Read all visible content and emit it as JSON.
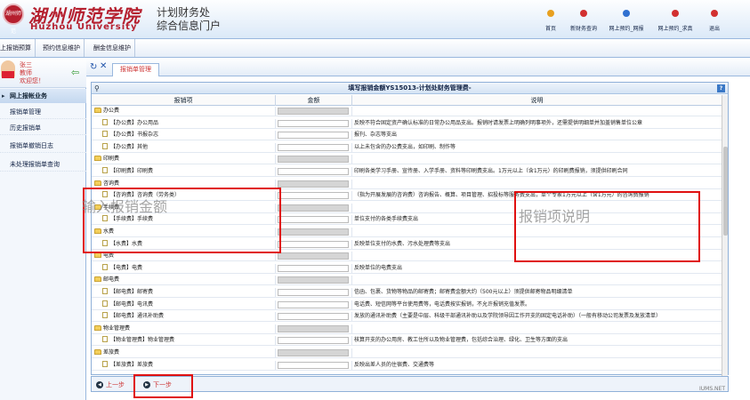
{
  "header": {
    "logo_text": "湖州师范",
    "school_cn": "湖州师范学院",
    "school_en": "Huzhou University",
    "system_line1": "计划财务处",
    "system_line2": "综合信息门户",
    "nav": [
      {
        "label": "首页",
        "color": "#e8a020"
      },
      {
        "label": "新财务查询",
        "color": "#d23030"
      },
      {
        "label": "网上预约_网报",
        "color": "#3070d0"
      },
      {
        "label": "网上预约_求真",
        "color": "#d23030"
      },
      {
        "label": "退出",
        "color": "#d23030"
      }
    ]
  },
  "menubar": {
    "tabs": [
      "上报销预算",
      "预约信息维护",
      "酬金信息维护"
    ]
  },
  "sidebar": {
    "user_name": "张三",
    "user_role": "教师",
    "welcome": "欢迎您！",
    "section": "网上报帐业务",
    "items": [
      "报销单管理",
      "历史报销单",
      "报销单撤销日志",
      "未处理报销单查询"
    ]
  },
  "tabs": {
    "active": "报销单管理"
  },
  "panel": {
    "title": "填写报销金额YS15013-计划处财务管理费-",
    "col_item": "报销项",
    "col_amount": "金额",
    "col_desc": "说明"
  },
  "rows": [
    {
      "type": "cat",
      "label": "办公费",
      "desc": ""
    },
    {
      "type": "item",
      "label": "【办公费】办公用品",
      "desc": "反映不符合固定资产确认标准的日常办公用品支出。报销时请发票上明确列明事项外，还需提供明细单并加盖销售单位公章"
    },
    {
      "type": "item",
      "label": "【办公费】书报杂志",
      "desc": "报刊、杂志等支出"
    },
    {
      "type": "item",
      "label": "【办公费】其他",
      "desc": "以上未包含的办公费支出，如印刷、制作等"
    },
    {
      "type": "cat",
      "label": "印刷费",
      "desc": ""
    },
    {
      "type": "item",
      "label": "【印刷费】印刷费",
      "desc": "印刷各类学习手册、宣传册、入学手册、资料等印刷费支出。1万元以上（含1万元）的印刷费报销，须提供印刷合同"
    },
    {
      "type": "cat",
      "label": "咨询费",
      "desc": ""
    },
    {
      "type": "item",
      "label": "【咨询费】咨询费（劳务类）",
      "desc": "（指为开展发展的咨询费）咨询报告、概算、项目管理、招投标等服务费支出，单个专家1万元以上（含1万元）的咨询费报销"
    },
    {
      "type": "cat",
      "label": "手续费",
      "desc": ""
    },
    {
      "type": "item",
      "label": "【手续费】手续费",
      "desc": "单位支付的各类手续费支出"
    },
    {
      "type": "cat",
      "label": "水费",
      "desc": ""
    },
    {
      "type": "item",
      "label": "【水费】水费",
      "desc": "反映单位支付的水费、污水处理费等支出"
    },
    {
      "type": "cat",
      "label": "电费",
      "desc": ""
    },
    {
      "type": "item",
      "label": "【电费】电费",
      "desc": "反映单位的电费支出"
    },
    {
      "type": "cat",
      "label": "邮电费",
      "desc": ""
    },
    {
      "type": "item",
      "label": "【邮电费】邮寄费",
      "desc": "信函、包裹、货物等物品的邮寄费；邮寄费金额大约（500元以上）须提供邮寄物品明细清单"
    },
    {
      "type": "item",
      "label": "【邮电费】电讯费",
      "desc": "电话费、短信网等平台使用费等，电话费按实报销，不允许报销充值发票。"
    },
    {
      "type": "item",
      "label": "【邮电费】通讯补助费",
      "desc": "发放的通讯补助费（主要是中层、科级干部通讯补助以及学院领导因工作开支的固定电话补助）（一般有移动公司发票及发放清单）"
    },
    {
      "type": "cat",
      "label": "物业管理费",
      "desc": ""
    },
    {
      "type": "item",
      "label": "【物业管理费】物业管理费",
      "desc": "核算开支的办公用房、教工住所以及物业管理费，包括综合治理、绿化、卫生等方面的支出"
    },
    {
      "type": "cat",
      "label": "差旅费",
      "desc": ""
    },
    {
      "type": "item",
      "label": "【差旅费】差旅费",
      "desc": "反映出差人员的住宿费、交通费等"
    }
  ],
  "footer": {
    "prev_label": "上一步",
    "next_label": "下一步"
  },
  "annotations": {
    "left_text": "输入报销金额",
    "right_text": "报销项说明"
  },
  "watermark": "IUMS.NET"
}
